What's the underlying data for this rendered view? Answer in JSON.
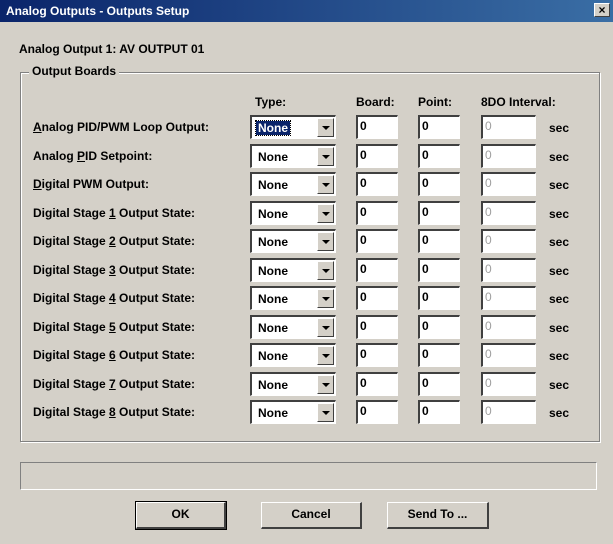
{
  "window": {
    "title": "Analog Outputs - Outputs Setup",
    "close_label": "×"
  },
  "subtitle": "Analog Output 1: AV OUTPUT 01",
  "group": {
    "legend": "Output Boards"
  },
  "columns": {
    "type": "Type:",
    "board": "Board:",
    "point": "Point:",
    "interval": "8DO Interval:"
  },
  "rows": [
    {
      "pre": "",
      "u": "A",
      "post": "nalog PID/PWM Loop Output:",
      "type": "None",
      "board": "0",
      "point": "0",
      "interval": "0",
      "unit": "sec"
    },
    {
      "pre": "Analog ",
      "u": "P",
      "post": "ID Setpoint:",
      "type": "None",
      "board": "0",
      "point": "0",
      "interval": "0",
      "unit": "sec"
    },
    {
      "pre": "",
      "u": "D",
      "post": "igital PWM Output:",
      "type": "None",
      "board": "0",
      "point": "0",
      "interval": "0",
      "unit": "sec"
    },
    {
      "pre": "Digital Stage ",
      "u": "1",
      "post": " Output State:",
      "type": "None",
      "board": "0",
      "point": "0",
      "interval": "0",
      "unit": "sec"
    },
    {
      "pre": "Digital Stage ",
      "u": "2",
      "post": " Output State:",
      "type": "None",
      "board": "0",
      "point": "0",
      "interval": "0",
      "unit": "sec"
    },
    {
      "pre": "Digital Stage ",
      "u": "3",
      "post": " Output State:",
      "type": "None",
      "board": "0",
      "point": "0",
      "interval": "0",
      "unit": "sec"
    },
    {
      "pre": "Digital Stage ",
      "u": "4",
      "post": " Output State:",
      "type": "None",
      "board": "0",
      "point": "0",
      "interval": "0",
      "unit": "sec"
    },
    {
      "pre": "Digital Stage ",
      "u": "5",
      "post": " Output State:",
      "type": "None",
      "board": "0",
      "point": "0",
      "interval": "0",
      "unit": "sec"
    },
    {
      "pre": "Digital Stage ",
      "u": "6",
      "post": " Output State:",
      "type": "None",
      "board": "0",
      "point": "0",
      "interval": "0",
      "unit": "sec"
    },
    {
      "pre": "Digital Stage ",
      "u": "7",
      "post": " Output State:",
      "type": "None",
      "board": "0",
      "point": "0",
      "interval": "0",
      "unit": "sec"
    },
    {
      "pre": "Digital Stage ",
      "u": "8",
      "post": " Output State:",
      "type": "None",
      "board": "0",
      "point": "0",
      "interval": "0",
      "unit": "sec"
    }
  ],
  "status_text": "",
  "buttons": {
    "ok": "OK",
    "cancel": "Cancel",
    "send_to": "Send To ..."
  },
  "colors": {
    "title_bar": "#0a246a",
    "face": "#d4d0c8"
  }
}
